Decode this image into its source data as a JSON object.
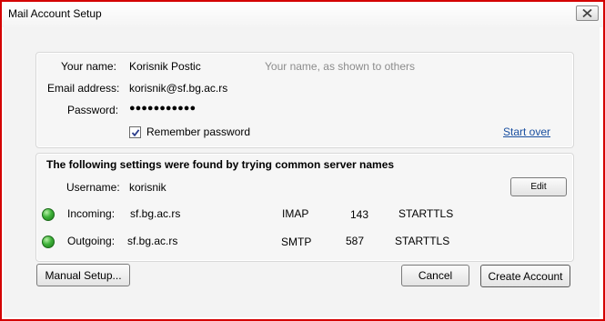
{
  "window": {
    "title": "Mail Account Setup"
  },
  "identity": {
    "name_label": "Your name:",
    "name_value": "Korisnik Postic",
    "name_hint": "Your name, as shown to others",
    "email_label": "Email address:",
    "email_value": "korisnik@sf.bg.ac.rs",
    "password_label": "Password:",
    "password_value": "●●●●●●●●●●●",
    "remember_label": "Remember password",
    "remember_checked": true,
    "start_over": "Start over"
  },
  "settings": {
    "heading": "The following settings were found by trying common server names",
    "username_label": "Username:",
    "username_value": "korisnik",
    "edit_button": "Edit",
    "incoming": {
      "label": "Incoming:",
      "server": "sf.bg.ac.rs",
      "protocol": "IMAP",
      "port": "143",
      "security": "STARTTLS",
      "status_color": "#3fb23a"
    },
    "outgoing": {
      "label": "Outgoing:",
      "server": "sf.bg.ac.rs",
      "protocol": "SMTP",
      "port": "587",
      "security": "STARTTLS",
      "status_color": "#3fb23a"
    }
  },
  "buttons": {
    "manual_setup": "Manual Setup...",
    "cancel": "Cancel",
    "create_account": "Create Account"
  },
  "colors": {
    "border": "#d40000",
    "link": "#1a4fa0",
    "hint": "#8c8c8c"
  }
}
